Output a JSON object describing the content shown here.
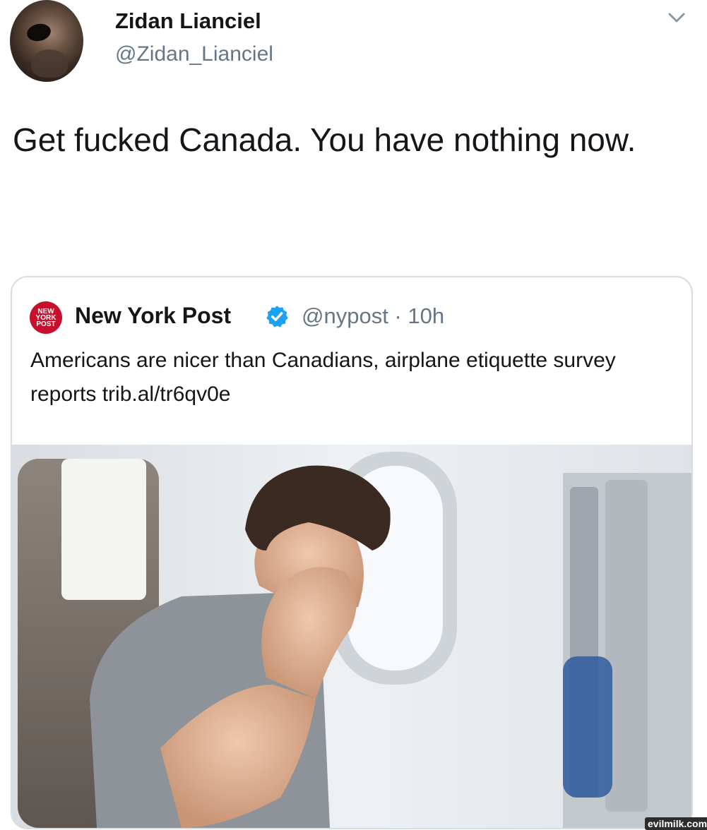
{
  "author": {
    "name": "Zidan Lianciel",
    "handle": "@Zidan_Lianciel"
  },
  "tweet": {
    "text": "Get fucked Canada. You have nothing now."
  },
  "quoted": {
    "logo_text": "NEW YORK POST",
    "name": "New York Post",
    "handle_time": "@nypost · 10h",
    "text": "Americans are nicer than Canadians, airplane etiquette survey reports trib.al/tr6qv0e"
  },
  "icons": {
    "menu": "chevron-down-icon",
    "verified": "verified-badge-icon"
  },
  "colors": {
    "verified": "#1da1f2",
    "nypost_red": "#c8102e",
    "secondary_text": "#657786"
  },
  "watermark": "evilmilk.com"
}
